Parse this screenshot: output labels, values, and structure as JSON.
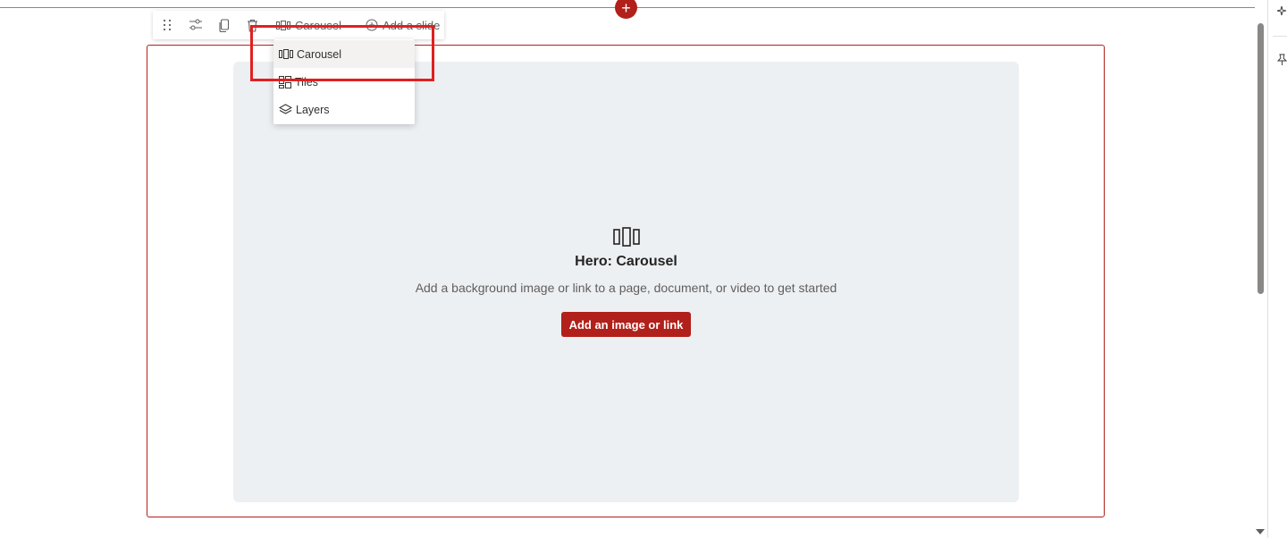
{
  "toolbar": {
    "drag_handle_icon": "drag-dots-icon",
    "settings_icon": "sliders-icon",
    "duplicate_icon": "copy-icon",
    "delete_icon": "trash-icon",
    "layout_label": "Carousel",
    "add_slide_label": "Add a slide"
  },
  "layout_menu": {
    "items": [
      {
        "label": "Carousel",
        "icon": "carousel-icon",
        "selected": true
      },
      {
        "label": "Tiles",
        "icon": "tiles-icon",
        "selected": false
      },
      {
        "label": "Layers",
        "icon": "layers-icon",
        "selected": false
      }
    ]
  },
  "hero": {
    "title": "Hero: Carousel",
    "description": "Add a background image or link to a page, document, or video to get started",
    "button_label": "Add an image or link"
  },
  "colors": {
    "accent": "#b1201a",
    "annotation": "#e02020",
    "hero_background": "#edf0f3"
  }
}
